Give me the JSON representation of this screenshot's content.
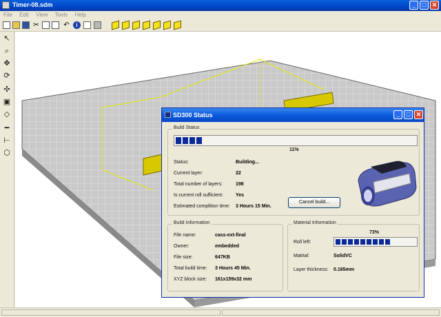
{
  "window": {
    "title": "Timer-08.sdm",
    "min": "_",
    "max": "□",
    "close": "✕"
  },
  "menu": [
    "File",
    "Edit",
    "View",
    "Tools",
    "Help"
  ],
  "dialog": {
    "title": "SD300 Status",
    "controls": {
      "min": "_",
      "max": "□",
      "close": "✕"
    },
    "build_status": {
      "legend": "Build Status",
      "progress_percent": 11,
      "progress_label": "11%",
      "rows": [
        {
          "label": "Status:",
          "value": "Building..."
        },
        {
          "label": "Current layer:",
          "value": "22"
        },
        {
          "label": "Total number of layers:",
          "value": "198"
        },
        {
          "label": "Is current roll sufficient:",
          "value": "Yes"
        },
        {
          "label": "Estimated complition time:",
          "value": "3 Hours 15 Min."
        }
      ],
      "cancel_label": "Cancel build..."
    },
    "build_info": {
      "legend": "Build Information",
      "rows": [
        {
          "label": "File name:",
          "value": "cass-ext-final"
        },
        {
          "label": "Owner:",
          "value": "embedded"
        },
        {
          "label": "File size:",
          "value": "647KB"
        },
        {
          "label": "Total build time:",
          "value": "3 Hours 45 Min."
        },
        {
          "label": "XYZ block size:",
          "value": "161x159x32 mm"
        }
      ]
    },
    "material_info": {
      "legend": "Material Information",
      "roll_percent": 73,
      "roll_label": "73%",
      "roll_left_label": "Roll left:",
      "material_label": "Matrial:",
      "material_value": "SolidVC",
      "thickness_label": "Layer thickness:",
      "thickness_value": "0.165mm"
    }
  }
}
